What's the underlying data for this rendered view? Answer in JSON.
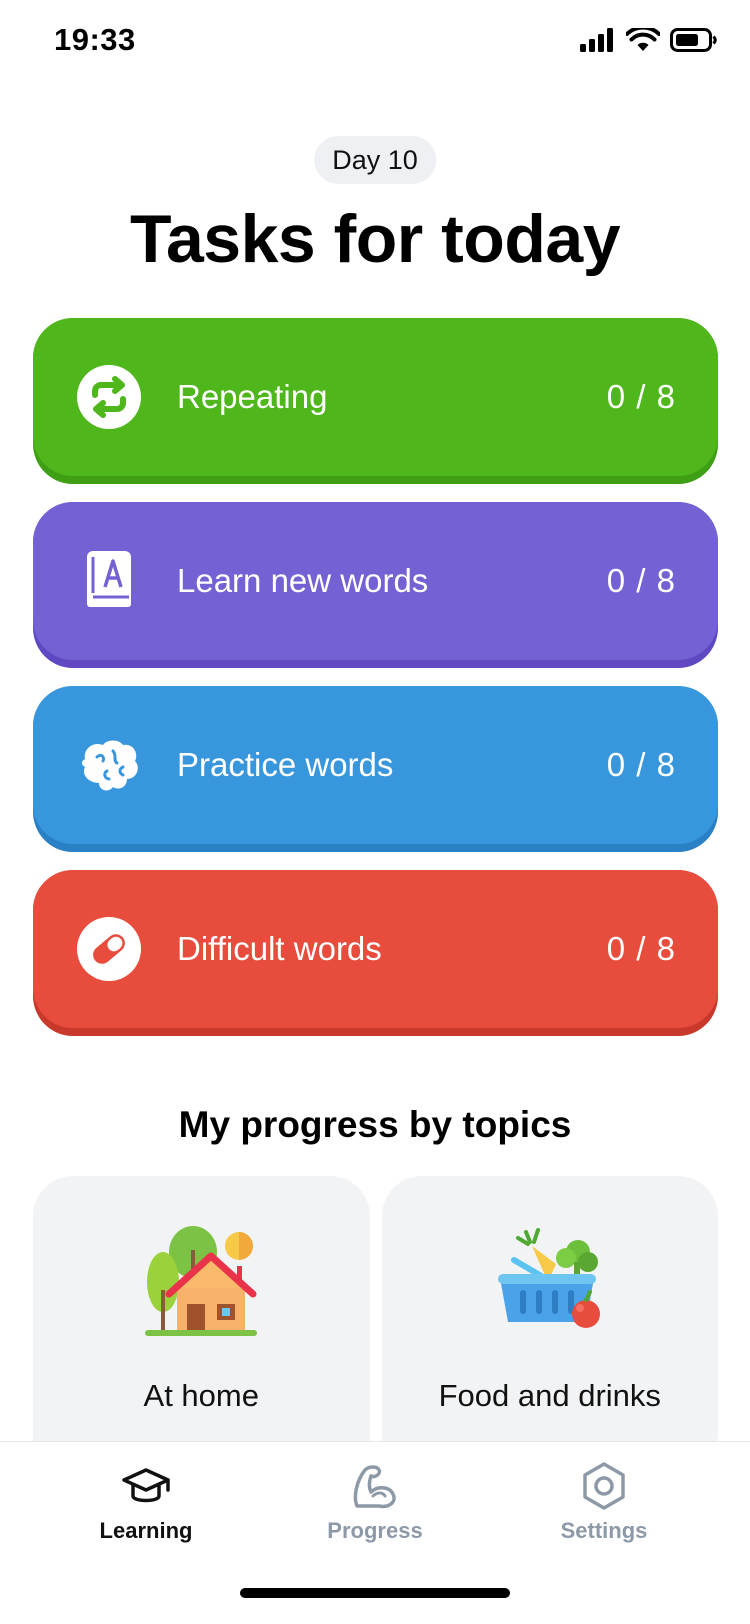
{
  "status_bar": {
    "time": "19:33"
  },
  "header": {
    "day_badge": "Day 10",
    "title": "Tasks for today"
  },
  "tasks": [
    {
      "label": "Repeating",
      "count": "0 / 8",
      "icon": "repeat-icon",
      "color": "#4fb71b"
    },
    {
      "label": "Learn new words",
      "count": "0 / 8",
      "icon": "book-icon",
      "color": "#7462d4"
    },
    {
      "label": "Practice words",
      "count": "0 / 8",
      "icon": "brain-icon",
      "color": "#3897dc"
    },
    {
      "label": "Difficult words",
      "count": "0 / 8",
      "icon": "pill-icon",
      "color": "#e84c3d"
    }
  ],
  "progress_section": {
    "title": "My progress by topics",
    "topics": [
      {
        "label": "At home",
        "icon": "house-icon"
      },
      {
        "label": "Food and drinks",
        "icon": "basket-icon"
      }
    ]
  },
  "tab_bar": {
    "tabs": [
      {
        "label": "Learning",
        "icon": "graduation-cap-icon",
        "active": true
      },
      {
        "label": "Progress",
        "icon": "muscle-icon",
        "active": false
      },
      {
        "label": "Settings",
        "icon": "settings-hexagon-icon",
        "active": false
      }
    ],
    "active_color": "#111111",
    "inactive_color": "#8e99a7"
  }
}
